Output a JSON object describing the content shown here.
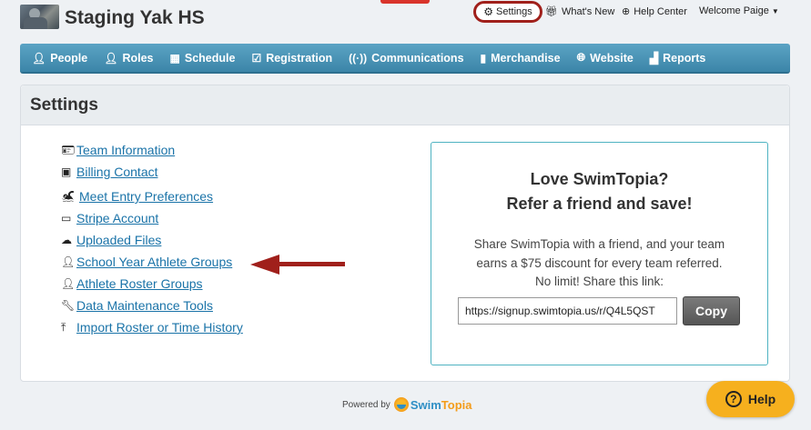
{
  "header": {
    "team_name": "Staging Yak HS",
    "settings_label": "Settings",
    "whats_new_label": "What's New",
    "help_center_label": "Help Center",
    "welcome_label": "Welcome Paige"
  },
  "nav": {
    "items": [
      {
        "label": "People",
        "icon": "person-icon"
      },
      {
        "label": "Roles",
        "icon": "roles-icon"
      },
      {
        "label": "Schedule",
        "icon": "calendar-icon"
      },
      {
        "label": "Registration",
        "icon": "clipboard-check-icon"
      },
      {
        "label": "Communications",
        "icon": "broadcast-icon"
      },
      {
        "label": "Merchandise",
        "icon": "shopping-bag-icon"
      },
      {
        "label": "Website",
        "icon": "globe-icon"
      },
      {
        "label": "Reports",
        "icon": "bar-chart-icon"
      }
    ]
  },
  "settings": {
    "title": "Settings",
    "links": [
      {
        "label": "Team Information",
        "icon": "id-card-icon"
      },
      {
        "label": "Billing Contact",
        "icon": "contact-card-icon"
      },
      {
        "label": "Meet Entry Preferences",
        "icon": "swimmer-icon"
      },
      {
        "label": "Stripe Account",
        "icon": "credit-card-icon"
      },
      {
        "label": "Uploaded Files",
        "icon": "cloud-upload-icon"
      },
      {
        "label": "School Year Athlete Groups",
        "icon": "group-icon"
      },
      {
        "label": "Athlete Roster Groups",
        "icon": "group-icon"
      },
      {
        "label": "Data Maintenance Tools",
        "icon": "wrench-icon"
      },
      {
        "label": "Import Roster or Time History",
        "icon": "upload-icon"
      }
    ]
  },
  "referral": {
    "heading_line1": "Love SwimTopia?",
    "heading_line2": "Refer a friend and save!",
    "body_line1": "Share SwimTopia with a friend, and your team",
    "body_line2": "earns a $75 discount for every team referred.",
    "body_line3": "No limit! Share this link:",
    "url": "https://signup.swimtopia.us/r/Q4L5QST",
    "copy_label": "Copy"
  },
  "footer": {
    "powered_by": "Powered by",
    "brand_swim": "Swim",
    "brand_topia": "Topia"
  },
  "help_button_label": "Help",
  "colors": {
    "nav_blue": "#3b85a8",
    "link_blue": "#1a73a8",
    "accent_red": "#a0201b",
    "help_orange": "#f6b01e",
    "referral_border": "#4fb3c2"
  }
}
